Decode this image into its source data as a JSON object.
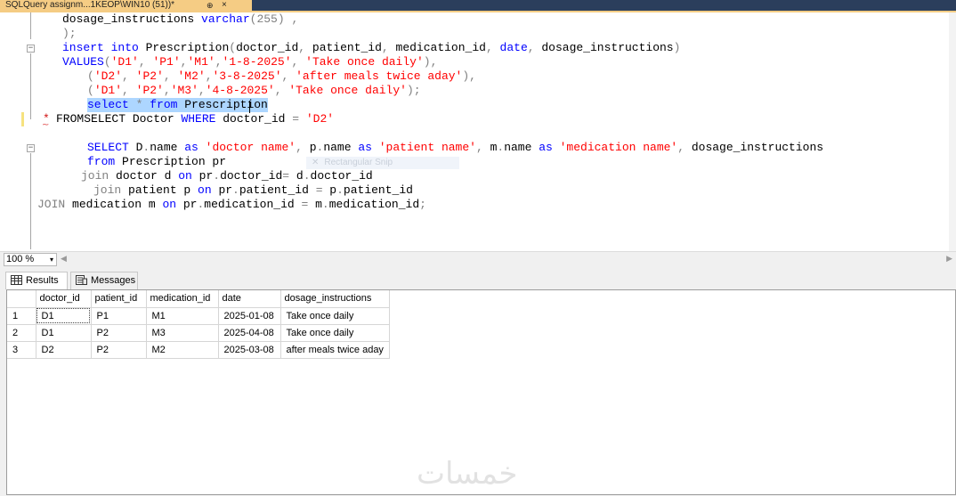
{
  "tab": {
    "title": "SQLQuery assignm...1KEOP\\WIN10 (51))*",
    "pin_icon": "⊕",
    "close_icon": "×"
  },
  "editor": {
    "lines": [
      [
        {
          "t": "dosage_instructions ",
          "c": "plain"
        },
        {
          "t": "varchar",
          "c": "kw"
        },
        {
          "t": "(255) ,",
          "c": "op"
        }
      ],
      [
        {
          "t": ");",
          "c": "op"
        }
      ],
      [
        {
          "t": "insert into ",
          "c": "kw"
        },
        {
          "t": "Prescription",
          "c": "plain"
        },
        {
          "t": "(",
          "c": "op"
        },
        {
          "t": "doctor_id",
          "c": "plain"
        },
        {
          "t": ", ",
          "c": "op"
        },
        {
          "t": "patient_id",
          "c": "plain"
        },
        {
          "t": ", ",
          "c": "op"
        },
        {
          "t": "medication_id",
          "c": "plain"
        },
        {
          "t": ", ",
          "c": "op"
        },
        {
          "t": "date",
          "c": "kw"
        },
        {
          "t": ", ",
          "c": "op"
        },
        {
          "t": "dosage_instructions",
          "c": "plain"
        },
        {
          "t": ")",
          "c": "op"
        }
      ],
      [
        {
          "t": "VALUES",
          "c": "kw"
        },
        {
          "t": "(",
          "c": "op"
        },
        {
          "t": "'D1'",
          "c": "str"
        },
        {
          "t": ", ",
          "c": "op"
        },
        {
          "t": "'P1'",
          "c": "str"
        },
        {
          "t": ",",
          "c": "op"
        },
        {
          "t": "'M1'",
          "c": "str"
        },
        {
          "t": ",",
          "c": "op"
        },
        {
          "t": "'1-8-2025'",
          "c": "str"
        },
        {
          "t": ", ",
          "c": "op"
        },
        {
          "t": "'Take once daily'",
          "c": "str"
        },
        {
          "t": "),",
          "c": "op"
        }
      ],
      [
        {
          "t": "(",
          "c": "op"
        },
        {
          "t": "'D2'",
          "c": "str"
        },
        {
          "t": ", ",
          "c": "op"
        },
        {
          "t": "'P2'",
          "c": "str"
        },
        {
          "t": ", ",
          "c": "op"
        },
        {
          "t": "'M2'",
          "c": "str"
        },
        {
          "t": ",",
          "c": "op"
        },
        {
          "t": "'3-8-2025'",
          "c": "str"
        },
        {
          "t": ", ",
          "c": "op"
        },
        {
          "t": "'after meals twice aday'",
          "c": "str"
        },
        {
          "t": "),",
          "c": "op"
        }
      ],
      [
        {
          "t": "(",
          "c": "op"
        },
        {
          "t": "'D1'",
          "c": "str"
        },
        {
          "t": ", ",
          "c": "op"
        },
        {
          "t": "'P2'",
          "c": "str"
        },
        {
          "t": ",",
          "c": "op"
        },
        {
          "t": "'M3'",
          "c": "str"
        },
        {
          "t": ",",
          "c": "op"
        },
        {
          "t": "'4-8-2025'",
          "c": "str"
        },
        {
          "t": ", ",
          "c": "op"
        },
        {
          "t": "'Take once daily'",
          "c": "str"
        },
        {
          "t": ");",
          "c": "op"
        }
      ],
      [
        {
          "t": "select ",
          "c": "kw"
        },
        {
          "t": "* ",
          "c": "op"
        },
        {
          "t": "from ",
          "c": "kw"
        },
        {
          "t": "Prescription",
          "c": "plain"
        }
      ],
      [
        {
          "t": "FROMSELECT Doctor ",
          "c": "plain"
        },
        {
          "t": "WHERE ",
          "c": "kw"
        },
        {
          "t": "doctor_id ",
          "c": "plain"
        },
        {
          "t": "= ",
          "c": "op"
        },
        {
          "t": "'D2'",
          "c": "str"
        }
      ],
      [],
      [
        {
          "t": "SELECT ",
          "c": "kw"
        },
        {
          "t": "D",
          "c": "plain"
        },
        {
          "t": ".",
          "c": "op"
        },
        {
          "t": "name ",
          "c": "plain"
        },
        {
          "t": "as ",
          "c": "kw"
        },
        {
          "t": "'doctor name'",
          "c": "str"
        },
        {
          "t": ", ",
          "c": "op"
        },
        {
          "t": "p",
          "c": "plain"
        },
        {
          "t": ".",
          "c": "op"
        },
        {
          "t": "name ",
          "c": "plain"
        },
        {
          "t": "as ",
          "c": "kw"
        },
        {
          "t": "'patient name'",
          "c": "str"
        },
        {
          "t": ", ",
          "c": "op"
        },
        {
          "t": "m",
          "c": "plain"
        },
        {
          "t": ".",
          "c": "op"
        },
        {
          "t": "name ",
          "c": "plain"
        },
        {
          "t": "as ",
          "c": "kw"
        },
        {
          "t": "'medication name'",
          "c": "str"
        },
        {
          "t": ", ",
          "c": "op"
        },
        {
          "t": "dosage_instructions",
          "c": "plain"
        }
      ],
      [
        {
          "t": "from ",
          "c": "kw"
        },
        {
          "t": "Prescription pr",
          "c": "plain"
        }
      ],
      [
        {
          "t": "join ",
          "c": "op"
        },
        {
          "t": "doctor d ",
          "c": "plain"
        },
        {
          "t": "on ",
          "c": "kw"
        },
        {
          "t": "pr",
          "c": "plain"
        },
        {
          "t": ".",
          "c": "op"
        },
        {
          "t": "doctor_id",
          "c": "plain"
        },
        {
          "t": "= ",
          "c": "op"
        },
        {
          "t": "d",
          "c": "plain"
        },
        {
          "t": ".",
          "c": "op"
        },
        {
          "t": "doctor_id",
          "c": "plain"
        }
      ],
      [
        {
          "t": "join ",
          "c": "op"
        },
        {
          "t": "patient p ",
          "c": "plain"
        },
        {
          "t": "on ",
          "c": "kw"
        },
        {
          "t": "pr",
          "c": "plain"
        },
        {
          "t": ".",
          "c": "op"
        },
        {
          "t": "patient_id ",
          "c": "plain"
        },
        {
          "t": "= ",
          "c": "op"
        },
        {
          "t": "p",
          "c": "plain"
        },
        {
          "t": ".",
          "c": "op"
        },
        {
          "t": "patient_id",
          "c": "plain"
        }
      ],
      [
        {
          "t": "JOIN ",
          "c": "op"
        },
        {
          "t": "medication m ",
          "c": "plain"
        },
        {
          "t": "on ",
          "c": "kw"
        },
        {
          "t": "pr",
          "c": "plain"
        },
        {
          "t": ".",
          "c": "op"
        },
        {
          "t": "medication_id ",
          "c": "plain"
        },
        {
          "t": "= ",
          "c": "op"
        },
        {
          "t": "m",
          "c": "plain"
        },
        {
          "t": ".",
          "c": "op"
        },
        {
          "t": "medication_id",
          "c": "plain"
        },
        {
          "t": ";",
          "c": "op"
        }
      ]
    ],
    "error_marker": "*",
    "ghost_hint": "Rectangular Snip"
  },
  "zoom": {
    "value": "100 %",
    "arrow": "▾"
  },
  "results_tabs": {
    "results_label": "Results",
    "messages_label": "Messages"
  },
  "grid": {
    "columns": [
      "doctor_id",
      "patient_id",
      "medication_id",
      "date",
      "dosage_instructions"
    ],
    "rows": [
      [
        "1",
        "D1",
        "P1",
        "M1",
        "2025-01-08",
        "Take once daily"
      ],
      [
        "2",
        "D1",
        "P2",
        "M3",
        "2025-04-08",
        "Take once daily"
      ],
      [
        "3",
        "D2",
        "P2",
        "M2",
        "2025-03-08",
        "after meals twice aday"
      ]
    ]
  },
  "watermark": "خمسات"
}
